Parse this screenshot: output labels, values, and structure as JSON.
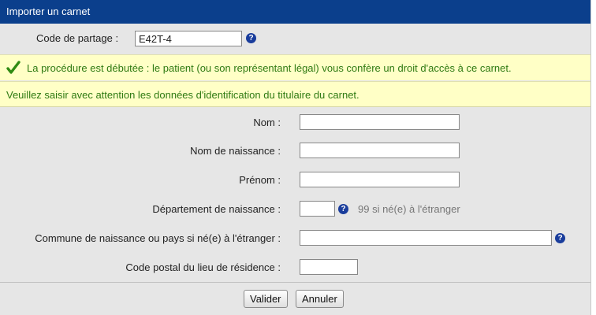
{
  "dialog": {
    "title": "Importer un carnet"
  },
  "share": {
    "label": "Code de partage :",
    "value": "E42T-4",
    "help_icon": "?"
  },
  "notices": {
    "procedure": "La procédure est débutée : le patient (ou son représentant légal) vous confère un droit d'accès à ce carnet.",
    "instruction": "Veuillez saisir avec attention les données d'identification du titulaire du carnet."
  },
  "form": {
    "nom_label": "Nom :",
    "nom_value": "",
    "nom_naissance_label": "Nom de naissance :",
    "nom_naissance_value": "",
    "prenom_label": "Prénom :",
    "prenom_value": "",
    "departement_label": "Département de naissance :",
    "departement_value": "",
    "departement_hint": "99 si né(e) à l'étranger",
    "commune_label": "Commune de naissance ou pays si né(e) à l'étranger :",
    "commune_value": "",
    "code_postal_label": "Code postal du lieu de résidence :",
    "code_postal_value": ""
  },
  "buttons": {
    "validate": "Valider",
    "cancel": "Annuler"
  },
  "colors": {
    "titlebar": "#0b3f8c",
    "notice_background": "#ffffc6",
    "notice_text": "#2f7a12",
    "dialog_background": "#e6e6e6"
  }
}
